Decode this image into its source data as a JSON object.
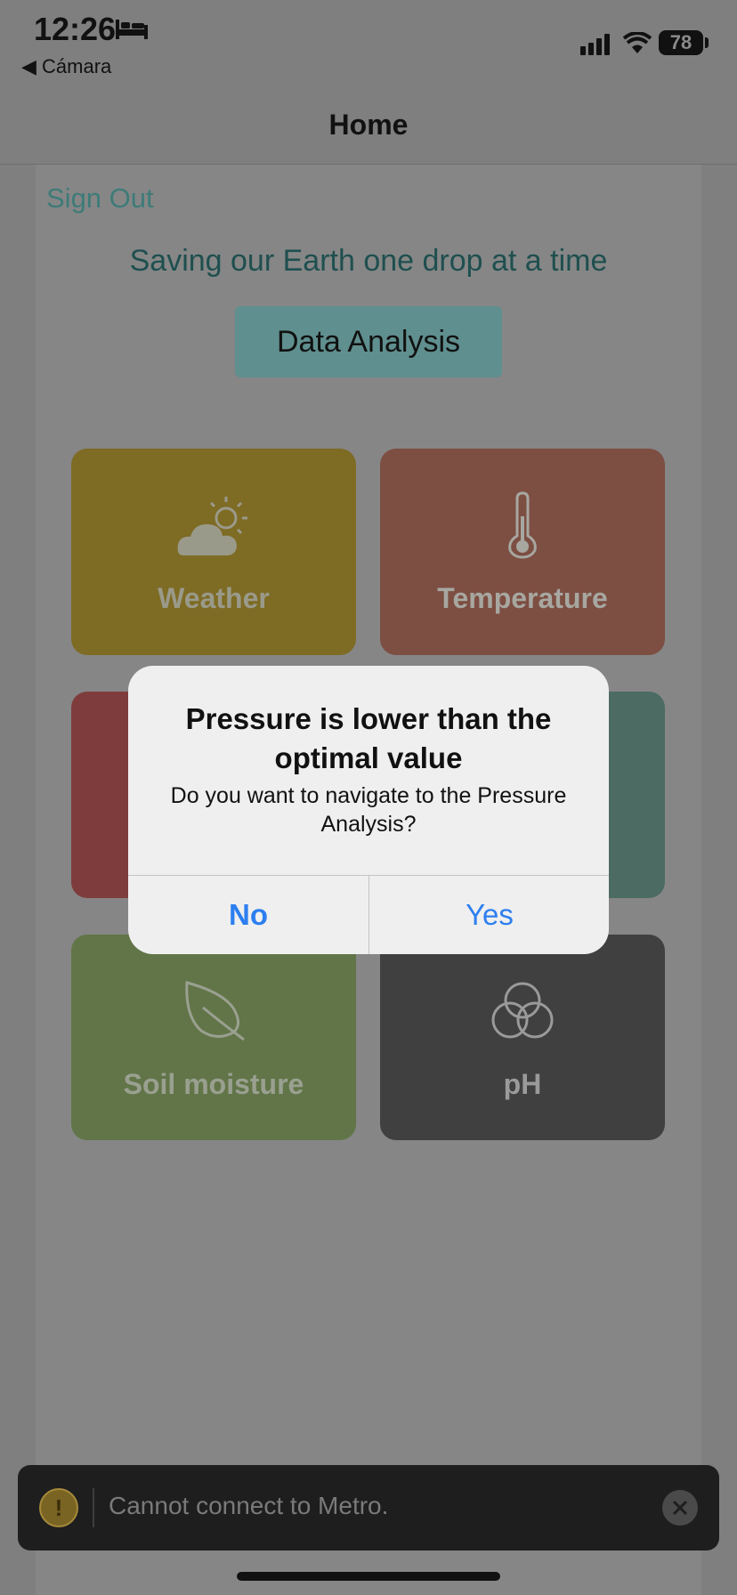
{
  "status_bar": {
    "time": "12:26",
    "back_app": "◀ Cámara",
    "battery": "78",
    "icons": [
      "bed-icon",
      "cellular-signal-icon",
      "wifi-icon",
      "battery-icon"
    ]
  },
  "nav": {
    "title": "Home"
  },
  "page": {
    "sign_out": "Sign Out",
    "tagline": "Saving our Earth one drop at a time",
    "data_analysis_button": "Data Analysis"
  },
  "tiles": [
    {
      "label": "Weather",
      "icon": "partly-cloudy-icon",
      "color": "#7e6b24"
    },
    {
      "label": "Temperature",
      "icon": "thermometer-icon",
      "color": "#7d4e42"
    },
    {
      "label": "",
      "icon": "",
      "color": "#7e3d3c"
    },
    {
      "label": "",
      "icon": "",
      "color": "#4b6b63"
    },
    {
      "label": "Soil moisture",
      "icon": "leaf-icon",
      "color": "#617548"
    },
    {
      "label": "pH",
      "icon": "overlapping-circles-icon",
      "color": "#404040"
    }
  ],
  "dialog": {
    "title": "Pressure is lower than the optimal value",
    "message": "Do you want to navigate to the Pressure Analysis?",
    "no_label": "No",
    "yes_label": "Yes",
    "button_color": "#2d7ff0"
  },
  "toast": {
    "text": "Cannot connect to Metro.",
    "icon": "warning-icon"
  }
}
